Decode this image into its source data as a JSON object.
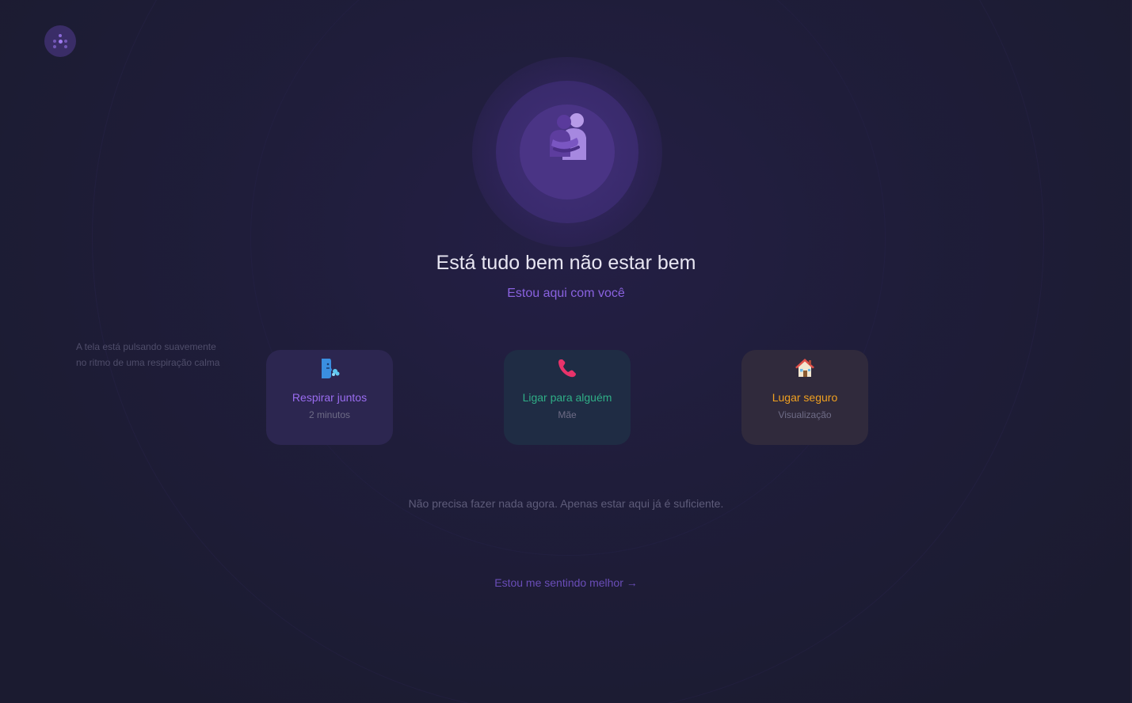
{
  "logo": {
    "icon": "breath-dots-icon"
  },
  "hero": {
    "icon": "people-hugging-icon",
    "title": "Está tudo bem não estar bem",
    "subtitle": "Estou aqui com você"
  },
  "side_note": {
    "line1": "A tela está pulsando suavemente",
    "line2": "no ritmo de uma respiração calma"
  },
  "actions": [
    {
      "icon": "breathing-face-icon",
      "label": "Respirar juntos",
      "sub": "2 minutos",
      "color": "#9a6cf0"
    },
    {
      "icon": "phone-icon",
      "label": "Ligar para alguém",
      "sub": "Mãe",
      "color": "#2fae86"
    },
    {
      "icon": "house-icon",
      "label": "Lugar seguro",
      "sub": "Visualização",
      "color": "#f0a020"
    }
  ],
  "reassurance": "Não precisa fazer nada agora. Apenas estar aqui já é suficiente.",
  "better_link": "Estou me sentindo melhor →",
  "colors": {
    "accent": "#8a62e0",
    "background": "#1f1d3a"
  }
}
